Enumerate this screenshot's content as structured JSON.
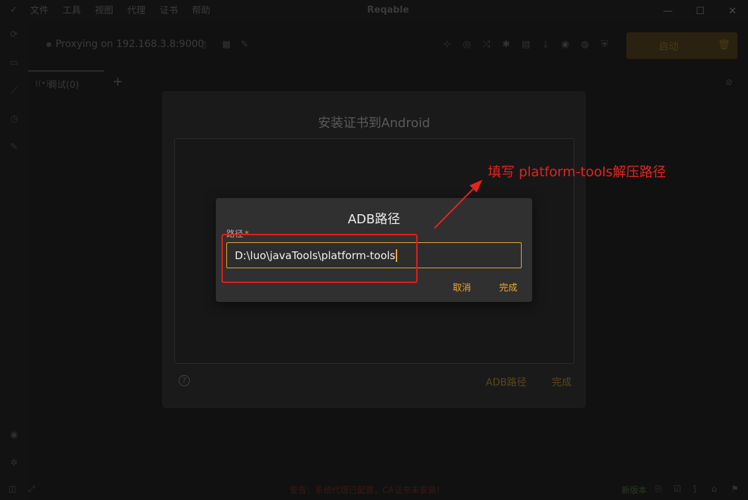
{
  "window": {
    "title": "Reqable",
    "menu": [
      "文件",
      "工具",
      "视图",
      "代理",
      "证书",
      "帮助"
    ]
  },
  "toolbar": {
    "proxy_status": "Proxying on 192.168.3.8:9000",
    "start_label": "启动"
  },
  "tabs": [
    {
      "label": "调试(0)"
    }
  ],
  "statusbar": {
    "warning": "警告：系统代理已配置，CA证书未安装！",
    "new_version": "新版本"
  },
  "outer_dialog": {
    "title": "安装证书到Android",
    "adb_path_button": "ADB路径",
    "done_button": "完成"
  },
  "adb_dialog": {
    "title": "ADB路径",
    "field_label": "路径",
    "required_mark": "*",
    "path_value": "D:\\luo\\javaTools\\platform-tools",
    "cancel_label": "取消",
    "done_label": "完成"
  },
  "annotation": {
    "text": "填写 platform-tools解压路径",
    "color": "#e8231f"
  },
  "colors": {
    "accent": "#f0a92f",
    "dialog_bg": "#303030",
    "overlay_bg": "#111111"
  }
}
